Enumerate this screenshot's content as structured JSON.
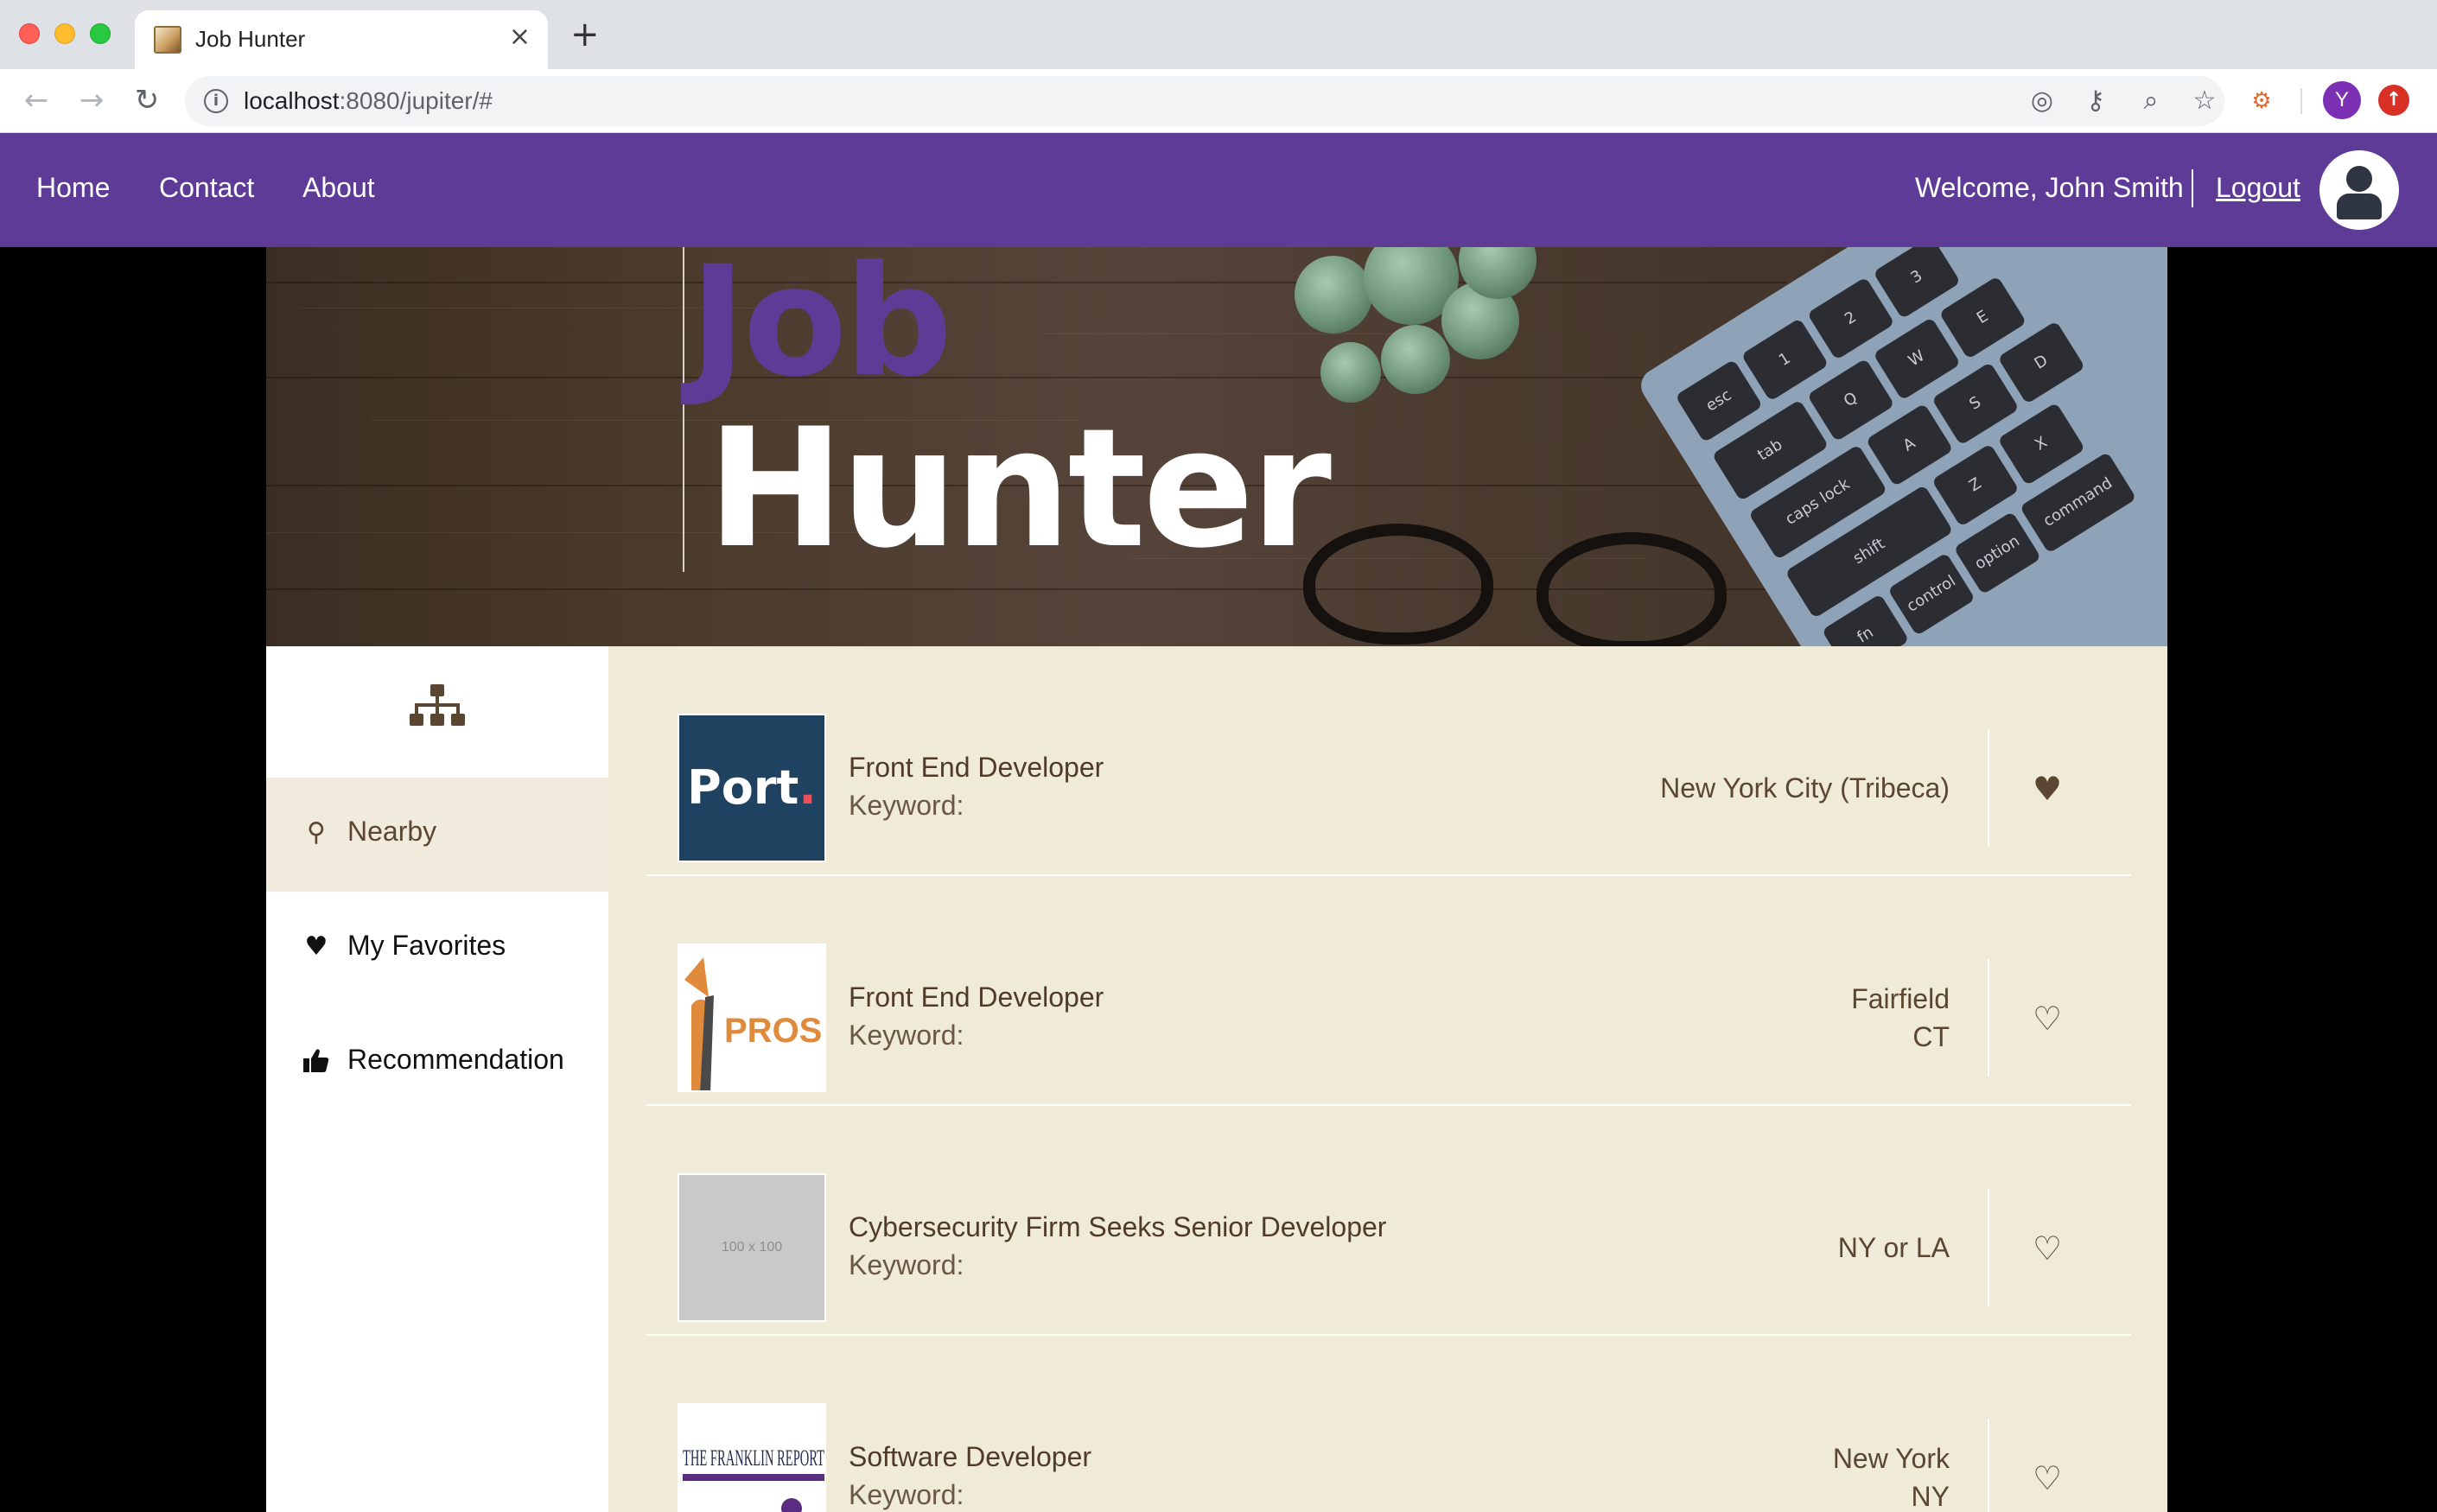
{
  "browser": {
    "tab_title": "Job Hunter",
    "tab_close": "×",
    "new_tab": "+",
    "url_host": "localhost",
    "url_rest": ":8080/jupiter/#",
    "profile_initial": "Y"
  },
  "nav": {
    "links": [
      "Home",
      "Contact",
      "About"
    ],
    "welcome": "Welcome, John Smith",
    "logout": "Logout"
  },
  "hero": {
    "title_line1": "Job",
    "title_line2": "Hunter"
  },
  "sidebar": {
    "items": [
      {
        "label": "Nearby",
        "icon": "map-pin-icon",
        "active": true
      },
      {
        "label": "My Favorites",
        "icon": "heart-icon",
        "active": false
      },
      {
        "label": "Recommendation",
        "icon": "thumbs-up-icon",
        "active": false
      }
    ]
  },
  "jobs": [
    {
      "title": "Front End Developer",
      "keyword": "Keyword:",
      "location": [
        "New York City (Tribeca)"
      ],
      "logo": "Port.",
      "favorite": true
    },
    {
      "title": "Front End Developer",
      "keyword": "Keyword:",
      "location": [
        "Fairfield",
        "CT"
      ],
      "logo": "PROSEK",
      "favorite": false
    },
    {
      "title": "Cybersecurity Firm Seeks Senior Developer",
      "keyword": "Keyword:",
      "location": [
        "NY or LA"
      ],
      "logo": "100 x 100",
      "favorite": false
    },
    {
      "title": "Software Developer",
      "keyword": "Keyword:",
      "location": [
        "New York",
        "NY"
      ],
      "logo": "THE FRANKLIN REPORT",
      "favorite": false
    }
  ],
  "colors": {
    "nav_purple": "#5e3b96",
    "content_beige": "#f0ead9",
    "text_brown": "#5a4631"
  }
}
